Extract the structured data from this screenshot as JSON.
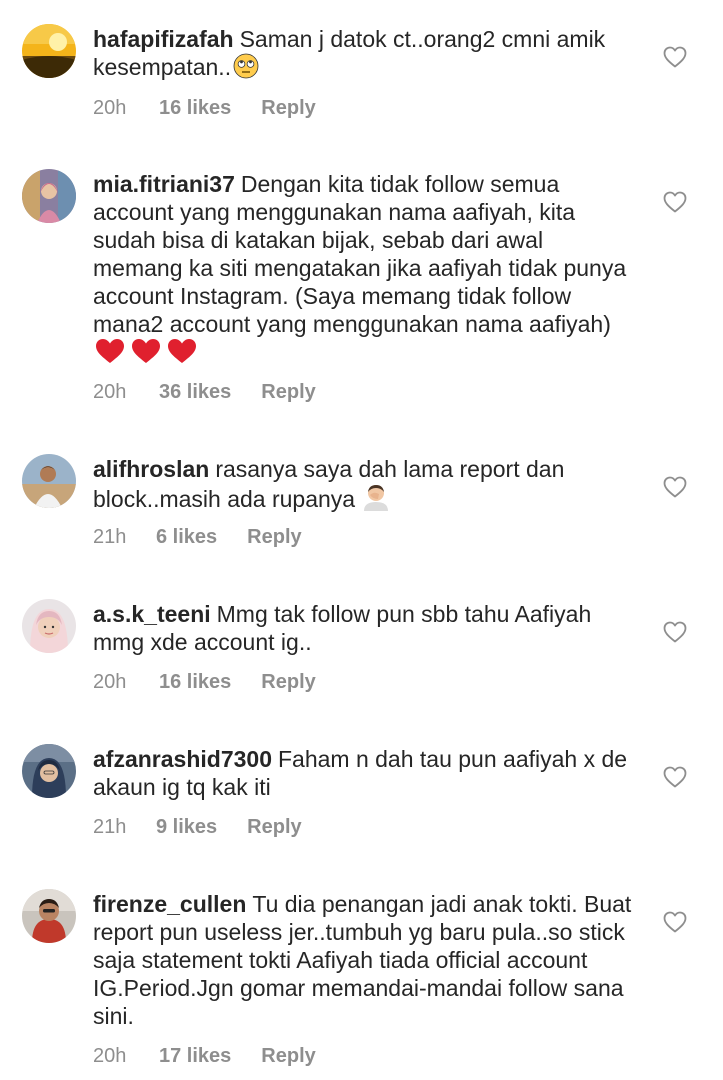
{
  "comments": [
    {
      "username": "hafapifizafah",
      "text": "Saman j datok ct..orang2 cmni amik kesempatan..",
      "emoji": "eye-roll-emoji",
      "time": "20h",
      "likes": "16 likes",
      "reply": "Reply"
    },
    {
      "username": "mia.fitriani37",
      "text": "Dengan kita tidak follow semua account yang menggunakan nama aafiyah, kita sudah bisa di katakan bijak, sebab dari awal memang ka siti mengatakan jika aafiyah tidak punya account Instagram. (Saya memang tidak follow mana2 account yang menggunakan nama aafiyah)",
      "emoji": "red-heart-emoji x3",
      "time": "20h",
      "likes": "36 likes",
      "reply": "Reply"
    },
    {
      "username": "alifhroslan",
      "text": "rasanya saya dah lama report dan block..masih ada rupanya",
      "emoji": "facepalm-emoji",
      "time": "21h",
      "likes": "6 likes",
      "reply": "Reply"
    },
    {
      "username": "a.s.k_teeni",
      "text": "Mmg tak follow pun sbb tahu Aafiyah mmg xde account ig..",
      "time": "20h",
      "likes": "16 likes",
      "reply": "Reply"
    },
    {
      "username": "afzanrashid7300",
      "text": "Faham n dah tau pun aafiyah x de akaun ig tq kak iti",
      "time": "21h",
      "likes": "9 likes",
      "reply": "Reply"
    },
    {
      "username": "firenze_cullen",
      "text": "Tu dia penangan jadi anak tokti. Buat report pun useless jer..tumbuh yg baru pula..so stick saja statement tokti Aafiyah tiada official account IG.Period.Jgn gomar memandai-mandai follow sana sini.",
      "time": "20h",
      "likes": "17 likes",
      "reply": "Reply"
    }
  ],
  "colors": {
    "text": "#262626",
    "meta": "#8e8e8e",
    "heart_outline": "#8e8e8e",
    "emoji_heart": "#e0202e"
  }
}
